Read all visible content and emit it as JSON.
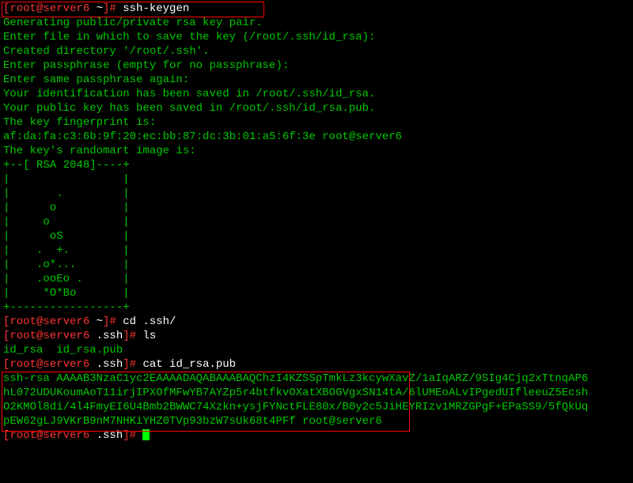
{
  "terminal": {
    "l1_prompt_user": "[root@server6 ",
    "l1_prompt_path": "~",
    "l1_prompt_hash": "]# ",
    "l1_cmd": "ssh-keygen",
    "l2": "Generating public/private rsa key pair.",
    "l3": "Enter file in which to save the key (/root/.ssh/id_rsa):",
    "l4": "Created directory '/root/.ssh'.",
    "l5": "Enter passphrase (empty for no passphrase):",
    "l6": "Enter same passphrase again:",
    "l7": "Your identification has been saved in /root/.ssh/id_rsa.",
    "l8": "Your public key has been saved in /root/.ssh/id_rsa.pub.",
    "l9": "The key fingerprint is:",
    "l10": "af:da:fa:c3:6b:9f:20:ec:bb:87:dc:3b:01:a5:6f:3e root@server6",
    "l11": "The key's randomart image is:",
    "l12": "+--[ RSA 2048]----+",
    "l13": "|                 |",
    "l14": "|       .         |",
    "l15": "|      o          |",
    "l16": "|     o           |",
    "l17": "|      oS         |",
    "l18": "|    .  +.        |",
    "l19": "|    .o*...       |",
    "l20": "|    .ooEo .      |",
    "l21": "|     *O*Bo       |",
    "l22": "+-----------------+",
    "l23_prompt_user": "[root@server6 ",
    "l23_prompt_path": "~",
    "l23_prompt_hash": "]# ",
    "l23_cmd": "cd .ssh/",
    "l24_prompt_user": "[root@server6 ",
    "l24_prompt_path": ".ssh",
    "l24_prompt_hash": "]# ",
    "l24_cmd": "ls",
    "l25": "id_rsa  id_rsa.pub",
    "l26_prompt_user": "[root@server6 ",
    "l26_prompt_path": ".ssh",
    "l26_prompt_hash": "]# ",
    "l26_cmd": "cat id_rsa.pub",
    "l27": "ssh-rsa AAAAB3NzaC1yc2EAAAADAQABAAABAQChzI4KZSSpTmkLz3kcywXavZ/1aIqARZ/9SIg4Cjq2xTtnqAP6",
    "l28": "hL072UDUKoumAoT11irjIPXOfMFwYB7AYZp5r4btfkvOXatXBOGVgxSN14tA/6lUMEoALvIPgedUIfleeuZ5Ecsh",
    "l29": "O2KMOl8di/4l4FmyEI6U4Bmb2BWWC74Xzkn+ysjFYNctFLE80x/B0y2c5JiHEYRIzv1MRZGPgF+EPaSS9/5fQkUq",
    "l30": "pEW62gLJ9VKrB9nM7NHKiYHZ0TVp93bzW7sUk68t4PFf root@server6"
  }
}
